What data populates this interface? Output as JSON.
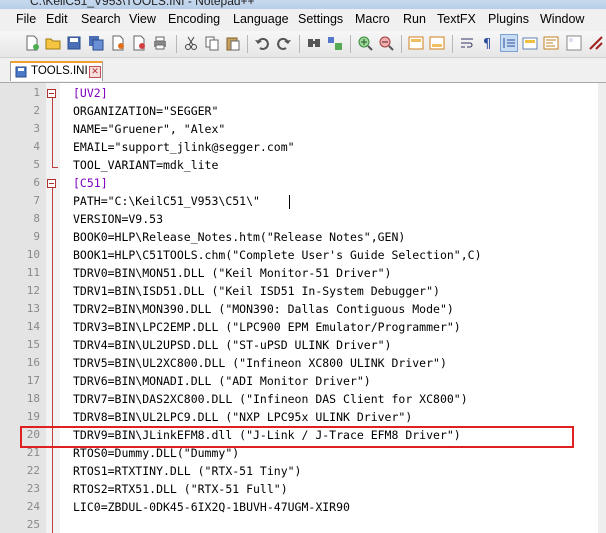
{
  "window": {
    "title": "C:\\KeilC51_V953\\TOOLS.INI - Notepad++"
  },
  "menu": [
    "File",
    "Edit",
    "Search",
    "View",
    "Encoding",
    "Language",
    "Settings",
    "Macro",
    "Run",
    "TextFX",
    "Plugins",
    "Window"
  ],
  "tab": {
    "label": "TOOLS.INI",
    "close": "✕"
  },
  "colors": {
    "section": "#8000c0",
    "fold_marker": "#c04040",
    "highlight": "#e02020"
  },
  "lines": [
    {
      "n": "1",
      "text": "[UV2]"
    },
    {
      "n": "2",
      "text": "ORGANIZATION=\"SEGGER\""
    },
    {
      "n": "3",
      "text": "NAME=\"Gruener\", \"Alex\""
    },
    {
      "n": "4",
      "text": "EMAIL=\"support_jlink@segger.com\""
    },
    {
      "n": "5",
      "text": "TOOL_VARIANT=mdk_lite"
    },
    {
      "n": "6",
      "text": "[C51]"
    },
    {
      "n": "7",
      "text": "PATH=\"C:\\KeilC51_V953\\C51\\\""
    },
    {
      "n": "8",
      "text": "VERSION=V9.53"
    },
    {
      "n": "9",
      "text": "BOOK0=HLP\\Release_Notes.htm(\"Release Notes\",GEN)"
    },
    {
      "n": "10",
      "text": "BOOK1=HLP\\C51TOOLS.chm(\"Complete User's Guide Selection\",C)"
    },
    {
      "n": "11",
      "text": "TDRV0=BIN\\MON51.DLL (\"Keil Monitor-51 Driver\")"
    },
    {
      "n": "12",
      "text": "TDRV1=BIN\\ISD51.DLL (\"Keil ISD51 In-System Debugger\")"
    },
    {
      "n": "13",
      "text": "TDRV2=BIN\\MON390.DLL (\"MON390: Dallas Contiguous Mode\")"
    },
    {
      "n": "14",
      "text": "TDRV3=BIN\\LPC2EMP.DLL (\"LPC900 EPM Emulator/Programmer\")"
    },
    {
      "n": "15",
      "text": "TDRV4=BIN\\UL2UPSD.DLL (\"ST-uPSD ULINK Driver\")"
    },
    {
      "n": "16",
      "text": "TDRV5=BIN\\UL2XC800.DLL (\"Infineon XC800 ULINK Driver\")"
    },
    {
      "n": "17",
      "text": "TDRV6=BIN\\MONADI.DLL (\"ADI Monitor Driver\")"
    },
    {
      "n": "18",
      "text": "TDRV7=BIN\\DAS2XC800.DLL (\"Infineon DAS Client for XC800\")"
    },
    {
      "n": "19",
      "text": "TDRV8=BIN\\UL2LPC9.DLL (\"NXP LPC95x ULINK Driver\")"
    },
    {
      "n": "20",
      "text": "TDRV9=BIN\\JLinkEFM8.dll (\"J-Link / J-Trace EFM8 Driver\")"
    },
    {
      "n": "21",
      "text": "RTOS0=Dummy.DLL(\"Dummy\")"
    },
    {
      "n": "22",
      "text": "RTOS1=RTXTINY.DLL (\"RTX-51 Tiny\")"
    },
    {
      "n": "23",
      "text": "RTOS2=RTX51.DLL (\"RTX-51 Full\")"
    },
    {
      "n": "24",
      "text": "LIC0=ZBDUL-0DK45-6IX2Q-1BUVH-47UGM-XIR90"
    },
    {
      "n": "25",
      "text": ""
    }
  ]
}
